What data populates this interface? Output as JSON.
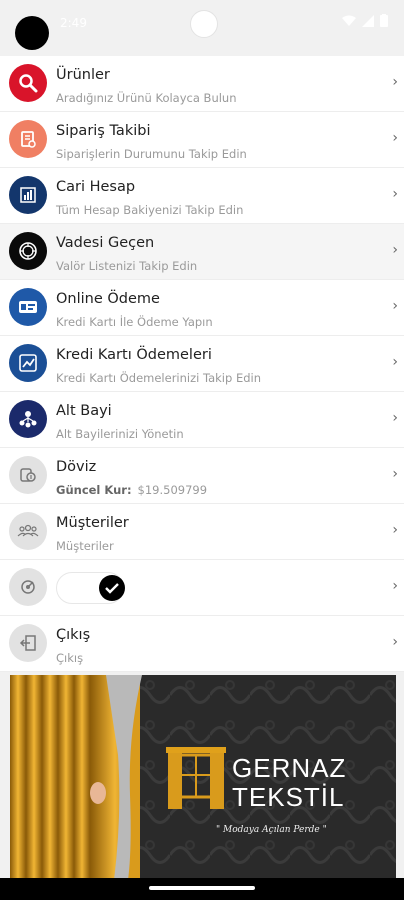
{
  "status_bar": {
    "time": "2:49"
  },
  "menu": {
    "items": [
      {
        "title": "Ürünler",
        "subtitle": "Aradığınız Ürünü Kolayca Bulun",
        "icon": "search-icon",
        "color": "#d9142a"
      },
      {
        "title": "Sipariş Takibi",
        "subtitle": "Siparişlerin Durumunu Takip Edin",
        "icon": "order-document-icon",
        "color": "#f07f63"
      },
      {
        "title": "Cari Hesap",
        "subtitle": "Tüm Hesap Bakiyenizi Takip Edin",
        "icon": "bar-chart-icon",
        "color": "#13366c"
      },
      {
        "title": "Vadesi Geçen",
        "subtitle": "Valör Listenizi Takip Edin",
        "icon": "target-icon",
        "color": "#0a0a0a"
      },
      {
        "title": "Online Ödeme",
        "subtitle": "Kredi Kartı İle Ödeme Yapın",
        "icon": "credit-card-icon",
        "color": "#1f59a8"
      },
      {
        "title": "Kredi Kartı Ödemeleri",
        "subtitle": "Kredi Kartı Ödemelerinizi Takip Edin",
        "icon": "card-chart-icon",
        "color": "#1b4f96"
      },
      {
        "title": "Alt Bayi",
        "subtitle": "Alt Bayilerinizi Yönetin",
        "icon": "dealer-network-icon",
        "color": "#1b2a6b"
      },
      {
        "title": "Döviz",
        "subtitle_label": "Güncel Kur:",
        "subtitle_value": "$19.509799",
        "icon": "currency-icon",
        "color": "#e2e2e2"
      },
      {
        "title": "Müşteriler",
        "subtitle": "Müşteriler",
        "icon": "customers-icon",
        "color": "#e2e2e2"
      },
      {
        "icon": "settings-icon",
        "color": "#e2e2e2",
        "toggle_on": true
      },
      {
        "title": "Çıkış",
        "subtitle": "Çıkış",
        "icon": "logout-icon",
        "color": "#e2e2e2"
      }
    ]
  },
  "banner": {
    "brand_line1": "GERNAZ",
    "brand_line2": "TEKSTİL",
    "slogan": "\" Modaya Açılan Perde \""
  },
  "colors": {
    "curtain": "#d99b1c",
    "accent": "#e0a11b"
  }
}
